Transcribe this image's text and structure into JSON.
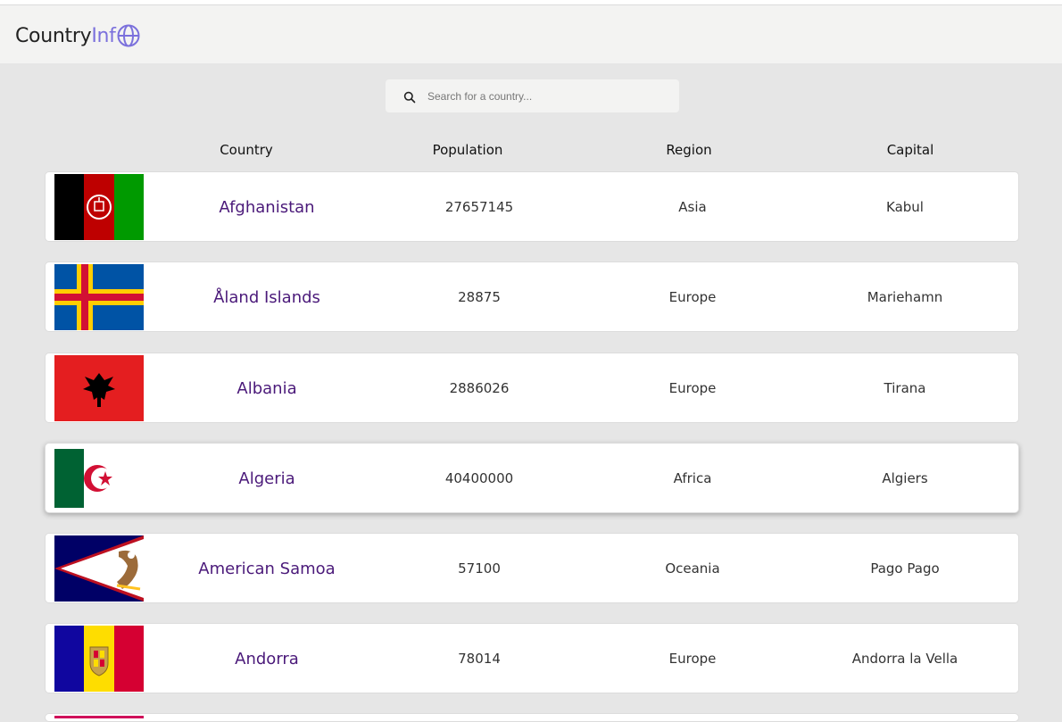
{
  "header": {
    "logo_main": "Country",
    "logo_accent": "Inf"
  },
  "search": {
    "placeholder": "Search for a country..."
  },
  "columns": {
    "country": "Country",
    "population": "Population",
    "region": "Region",
    "capital": "Capital"
  },
  "rows": [
    {
      "country": "Afghanistan",
      "population": "27657145",
      "region": "Asia",
      "capital": "Kabul"
    },
    {
      "country": "Åland Islands",
      "population": "28875",
      "region": "Europe",
      "capital": "Mariehamn"
    },
    {
      "country": "Albania",
      "population": "2886026",
      "region": "Europe",
      "capital": "Tirana"
    },
    {
      "country": "Algeria",
      "population": "40400000",
      "region": "Africa",
      "capital": "Algiers"
    },
    {
      "country": "American Samoa",
      "population": "57100",
      "region": "Oceania",
      "capital": "Pago Pago"
    },
    {
      "country": "Andorra",
      "population": "78014",
      "region": "Europe",
      "capital": "Andorra la Vella"
    }
  ],
  "colors": {
    "accent": "#7b70dc",
    "country_text": "#4b1a7a",
    "background": "#e6e6e6"
  }
}
